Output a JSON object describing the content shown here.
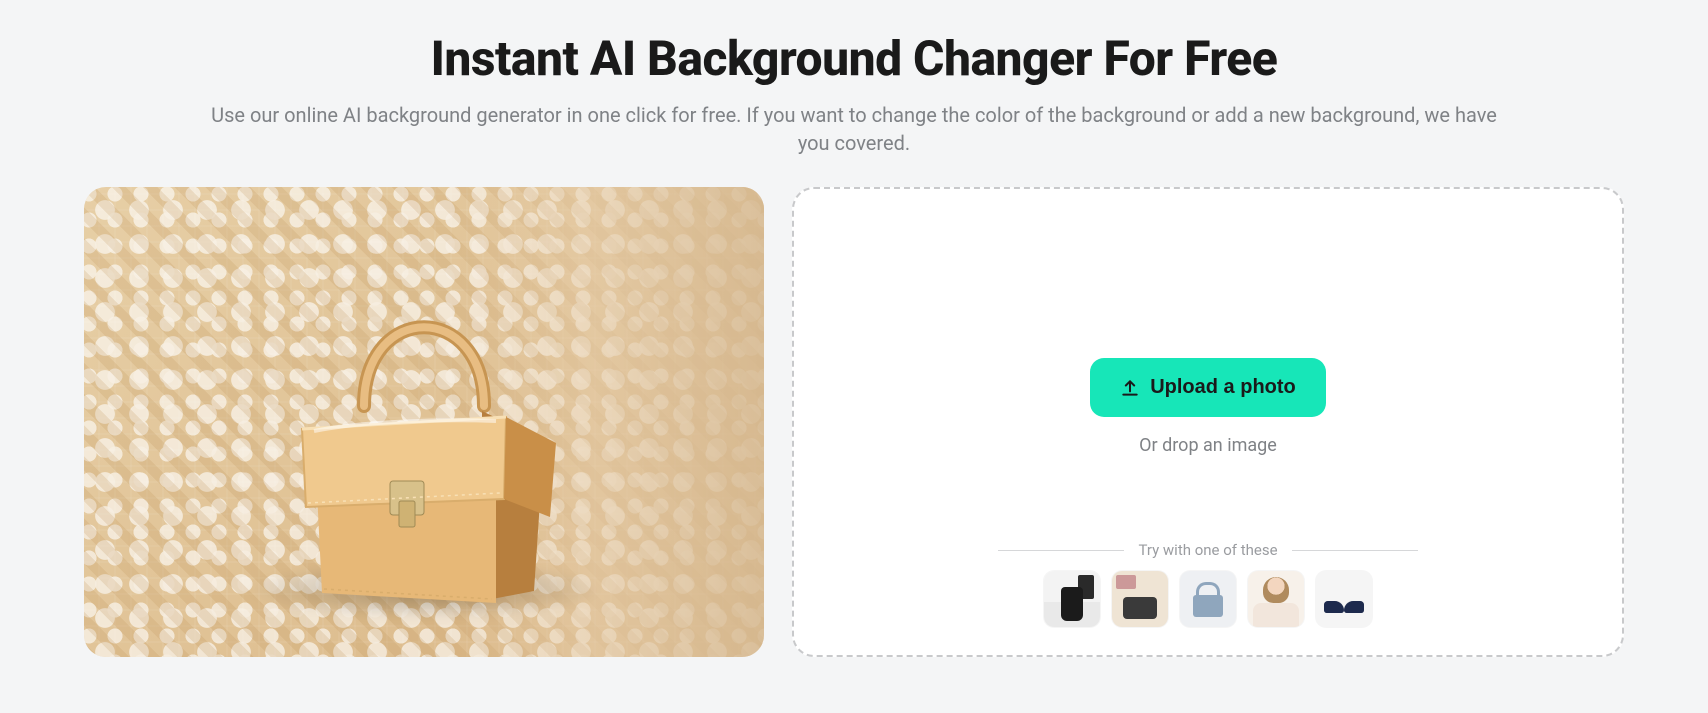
{
  "hero": {
    "title": "Instant AI Background Changer For Free",
    "subtitle": "Use our online AI background generator in one click for free. If you want to change the color of the background or add a new background, we have you covered."
  },
  "upload": {
    "button_label": "Upload a photo",
    "drop_label": "Or drop an image"
  },
  "samples": {
    "label": "Try with one of these",
    "items": [
      {
        "name": "coffee-cup"
      },
      {
        "name": "vintage-camera"
      },
      {
        "name": "blue-handbag"
      },
      {
        "name": "woman-with-hat"
      },
      {
        "name": "navy-shoes"
      }
    ]
  },
  "preview": {
    "subject": "tan-leather-handbag"
  }
}
